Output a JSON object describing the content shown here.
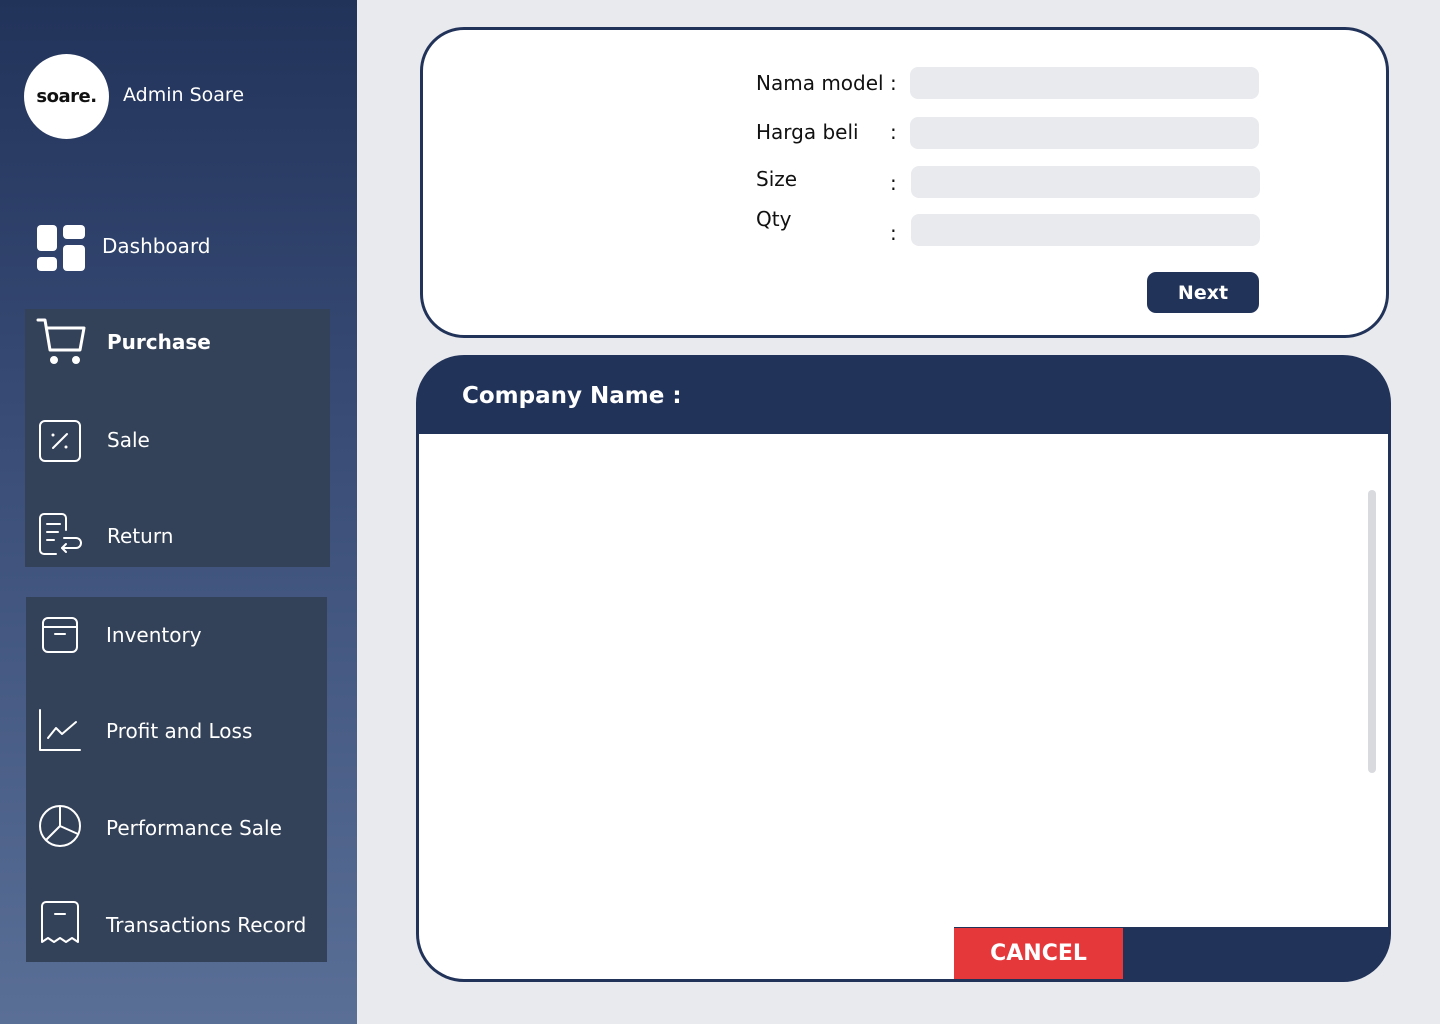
{
  "sidebar": {
    "logo_text": "soare.",
    "admin_name": "Admin Soare",
    "items": [
      {
        "label": "Dashboard",
        "icon": "dashboard-icon",
        "active": false
      },
      {
        "label": "Purchase",
        "icon": "cart-icon",
        "active": true
      },
      {
        "label": "Sale",
        "icon": "percent-icon",
        "active": false
      },
      {
        "label": "Return",
        "icon": "return-icon",
        "active": false
      },
      {
        "label": "Inventory",
        "icon": "archive-icon",
        "active": false
      },
      {
        "label": "Profit and Loss",
        "icon": "line-chart-icon",
        "active": false
      },
      {
        "label": "Performance Sale",
        "icon": "pie-chart-icon",
        "active": false
      },
      {
        "label": "Transactions Record",
        "icon": "receipt-icon",
        "active": false
      }
    ]
  },
  "form": {
    "fields": [
      {
        "label": "Nama model",
        "value": ""
      },
      {
        "label": "Harga beli",
        "value": ""
      },
      {
        "label": "Size",
        "value": ""
      },
      {
        "label": "Qty",
        "value": ""
      }
    ],
    "colon": ":",
    "next_label": "Next"
  },
  "company": {
    "title": "Company Name :",
    "cancel_label": "CANCEL"
  },
  "colors": {
    "navy": "#22335a",
    "group_bg": "#344259",
    "cancel_red": "#e5383b",
    "page_bg": "#e9eaee"
  }
}
